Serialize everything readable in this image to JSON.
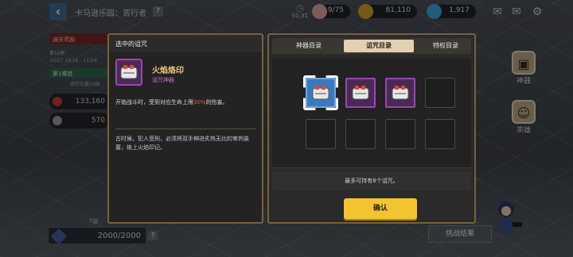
{
  "header": {
    "title": "卡马逊乐园：苦行者",
    "help": "?",
    "clock_time": "01:31",
    "resources": [
      {
        "name": "stamina",
        "value": "9/75",
        "color": "#e3a6a6"
      },
      {
        "name": "coins",
        "value": "81,110",
        "color": "#d7a32b"
      },
      {
        "name": "gems",
        "value": "1,917",
        "color": "#3fa7e0"
      }
    ]
  },
  "left_panel": {
    "header": "通关奖励",
    "season": "第16季",
    "dates": "10/27 14:16 - 11/24",
    "difficulty": "第1难度",
    "note": "进阶比赛10局",
    "stat1": "133,160",
    "stat2": "570",
    "floor": "7层",
    "progress": "2000/2000",
    "progress_help": "?"
  },
  "side_buttons": {
    "artifact": "神器",
    "hero": "英雄"
  },
  "challenge_result": "挑战结果",
  "detail": {
    "header": "选中的诅咒",
    "item_name": "火焰烙印",
    "item_type": "诅咒神器",
    "effect_pre": "开始战斗时，受到对应生命上限",
    "effect_hl": "30%",
    "effect_post": "的伤害。",
    "lore": "古时候，犯人受刑，必须将双手伸进炙热无比的审判装置，烙上火焰印记。"
  },
  "tabs": [
    {
      "label": "神器目录",
      "active": false
    },
    {
      "label": "诅咒目录",
      "active": true
    },
    {
      "label": "特权目录",
      "active": false
    }
  ],
  "slots": {
    "row1": [
      "selected",
      "filled",
      "filled",
      "empty"
    ],
    "row2": [
      "empty",
      "empty",
      "empty",
      "empty"
    ]
  },
  "capacity_text": "最多可持有8个诅咒。",
  "confirm_label": "确认",
  "colors": {
    "gold_border": "#7c5f3a",
    "confirm": "#f4c430",
    "rarity_purple": "#9a45b5",
    "selected_blue": "#3a78c0"
  }
}
